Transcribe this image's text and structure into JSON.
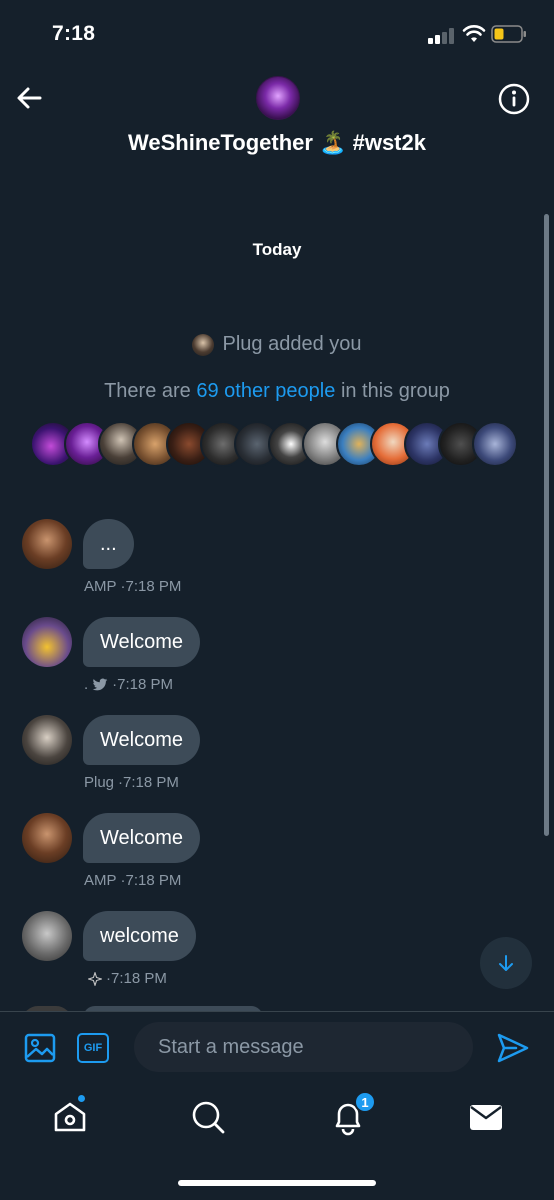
{
  "status": {
    "time": "7:18"
  },
  "header": {
    "title": "WeShineTogether 🏝️ #wst2k"
  },
  "conversation": {
    "day_label": "Today",
    "added_text": "Plug added you",
    "others_prefix": "There are",
    "others_link": "69 other people",
    "others_suffix": "in this group"
  },
  "messages": [
    {
      "text": "...",
      "author": "AMP",
      "time": "·7:18 PM",
      "author_icon": ""
    },
    {
      "text": "Welcome",
      "author": ".",
      "time": "·7:18 PM",
      "author_icon": "twitter-bird-icon"
    },
    {
      "text": "Welcome",
      "author": "Plug",
      "time": "·7:18 PM",
      "author_icon": ""
    },
    {
      "text": "Welcome",
      "author": "AMP",
      "time": "·7:18 PM",
      "author_icon": ""
    },
    {
      "text": "welcome",
      "author": "",
      "time": "·7:18 PM",
      "author_icon": "sparkle-star-icon"
    }
  ],
  "composer": {
    "placeholder": "Start a message",
    "gif_label": "GIF"
  },
  "tabbar": {
    "notifications_badge": "1"
  },
  "colors": {
    "background": "#15202b",
    "bubble": "#3d4b58",
    "accent": "#1d9bf0",
    "secondary_text": "#8b98a5"
  }
}
